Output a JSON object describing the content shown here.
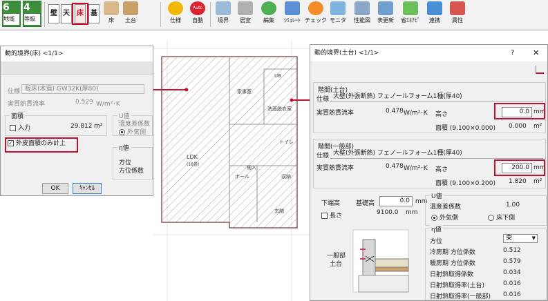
{
  "toolbar": {
    "region": {
      "num": "6",
      "label": "地域"
    },
    "grade": {
      "num": "4",
      "label": "等級"
    },
    "tabs": [
      "壁",
      "天",
      "床",
      "基"
    ],
    "buttons": [
      "床",
      "土台",
      "仕様",
      "自動",
      "境界",
      "居室",
      "編集",
      "ｼﾐｭﾚｰﾄ",
      "チェック",
      "モニタ",
      "性能図",
      "表更新",
      "省ｴﾈﾅﾋﾞ",
      "連携",
      "属性"
    ],
    "auto_badge": "Auto"
  },
  "left_dialog": {
    "title": "動的境界(床) <1/1>",
    "spec_label": "仕様",
    "spec_value": "板床(木造) GW32K(厚80)",
    "heat_label": "実質熱貫流率",
    "heat_value": "0.529",
    "heat_unit": "W/m²･K",
    "area_group": "面積",
    "input_label": "入力",
    "area_value": "29.812",
    "area_unit": "m²",
    "u_group": "U値",
    "u_temp": "温度差係数",
    "u_outside": "外気側",
    "eta_group": "η値",
    "eta_dir": "方位",
    "eta_coef": "方位係数",
    "outer_only": "外皮面積のみ計上",
    "ok": "OK",
    "cancel": "ｷｬﾝｾﾙ"
  },
  "plan": {
    "rooms": [
      "家事室",
      "UB",
      "洗面脱衣室",
      "トイレ",
      "LDK",
      "(18畳)",
      "納入",
      "ホール",
      "収納",
      "玄関"
    ]
  },
  "right_dialog": {
    "title": "動的境界(土台) <1/1>",
    "help": "?",
    "close": "✕",
    "sec1": {
      "title": "階間(土台)",
      "spec_label": "仕様",
      "spec_value": "大壁(外張断熱) フェノールフォーム1種(厚40)",
      "heat_label": "実質熱貫流率",
      "heat_value": "0.478",
      "heat_unit": "W/m²･K",
      "height_label": "高さ",
      "height_value": "0.0",
      "height_unit": "mm",
      "area_label": "面積 (9.100×0.000)",
      "area_value": "0.000",
      "area_unit": "m²"
    },
    "sec2": {
      "title": "階間(一般部)",
      "spec_label": "仕様",
      "spec_value": "大壁(外張断熱) フェノールフォーム1種(厚40)",
      "heat_label": "実質熱貫流率",
      "heat_value": "0.478",
      "heat_unit": "W/m²･K",
      "height_label": "高さ",
      "height_value": "200.0",
      "height_unit": "mm",
      "area_label": "面積 (9.100×0.200)",
      "area_value": "1.820",
      "area_unit": "m²"
    },
    "lower": {
      "bottom_label": "下端高",
      "base_label": "基礎高",
      "base_value": "0.0",
      "base_unit": "mm",
      "length_label": "長さ",
      "length_value": "9100.0",
      "length_unit": "mm",
      "diag_general": "一般部",
      "diag_sill": "土台"
    },
    "u": {
      "group": "U値",
      "temp_label": "温度差係数",
      "temp_value": "1.00",
      "outside": "外気側",
      "underfloor": "床下側"
    },
    "eta": {
      "group": "η値",
      "dir_label": "方位",
      "dir_value": "東",
      "rows": [
        {
          "label": "冷房期 方位係数",
          "value": "0.512"
        },
        {
          "label": "暖房期 方位係数",
          "value": "0.579"
        },
        {
          "label": "日射熱取得係数",
          "value": "0.034"
        },
        {
          "label": "日射熱取得率(土台)",
          "value": "0.016"
        },
        {
          "label": "日射熱取得率(一般部)",
          "value": "0.016"
        }
      ]
    }
  }
}
